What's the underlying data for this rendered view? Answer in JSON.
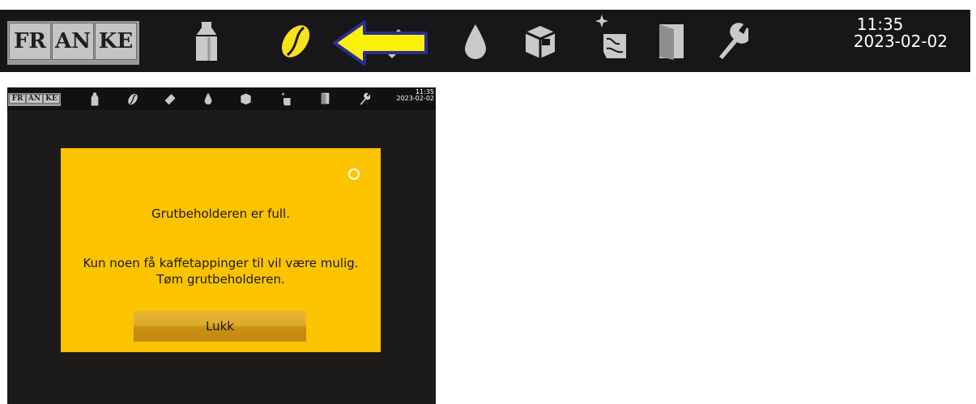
{
  "topbar": {
    "logo": "FRANKE",
    "logo_letters": [
      "FR",
      "AN",
      "KE"
    ],
    "time": "11:35",
    "date": "2023-02-02",
    "icons": [
      "milk-carton-icon",
      "coffee-bean-icon",
      "chocolate-icon",
      "water-drop-icon",
      "box-icon",
      "cleaning-icon",
      "door-icon",
      "wrench-icon"
    ],
    "active_icon": "coffee-bean-icon",
    "annotation": "arrow pointing to coffee-bean-icon"
  },
  "screen": {
    "time": "11:35",
    "date": "2023-02-02",
    "dialog": {
      "message_line1": "Grutbeholderen er full.",
      "message_line2": "Kun noen få kaffetappinger til vil være mulig.",
      "message_line3": "Tøm grutbeholderen.",
      "close_label": "Lukk"
    }
  },
  "colors": {
    "dialog_bg": "#fcc300",
    "bar_bg": "#17171a",
    "screen_bg": "#1d1a1a",
    "active_icon": "#f7e21a",
    "arrow_fill": "#f9f00b",
    "arrow_stroke": "#2a2e8c",
    "icon_gray": "#c9c9c9"
  }
}
